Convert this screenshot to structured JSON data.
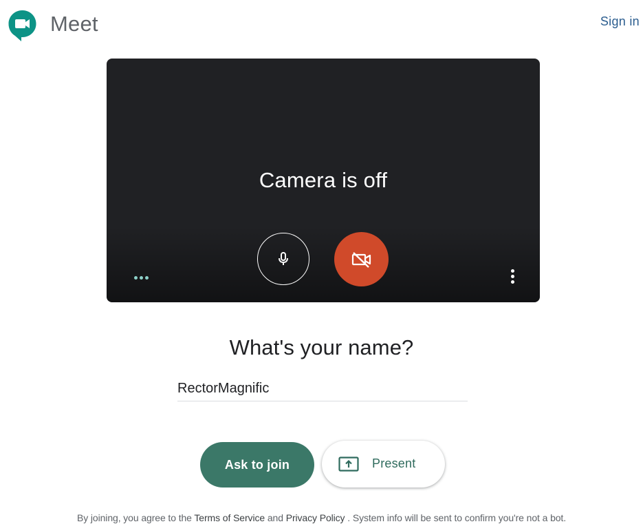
{
  "header": {
    "app_name": "Meet",
    "sign_in_label": "Sign in",
    "logo_icon": "meet-logo-icon"
  },
  "preview": {
    "status_text": "Camera is off",
    "mic_icon": "microphone-icon",
    "camera_icon": "camera-off-icon",
    "loading_icon": "three-dots-icon",
    "more_icon": "more-vertical-icon"
  },
  "name_section": {
    "prompt": "What's your name?",
    "name_value": "RectorMagnific"
  },
  "actions": {
    "ask_to_join_label": "Ask to join",
    "present_label": "Present",
    "present_icon": "present-screen-icon"
  },
  "footer": {
    "text_before": "By joining, you agree to the",
    "terms_link": "Terms of Service",
    "text_and": "and",
    "privacy_link": "Privacy Policy",
    "text_after": ". System info will be sent to confirm you're not a bot."
  },
  "colors": {
    "logo_green": "#00897b",
    "camera_off_red": "#d04a2a",
    "ask_button_green": "#3b7868",
    "preview_bg": "#202124"
  }
}
